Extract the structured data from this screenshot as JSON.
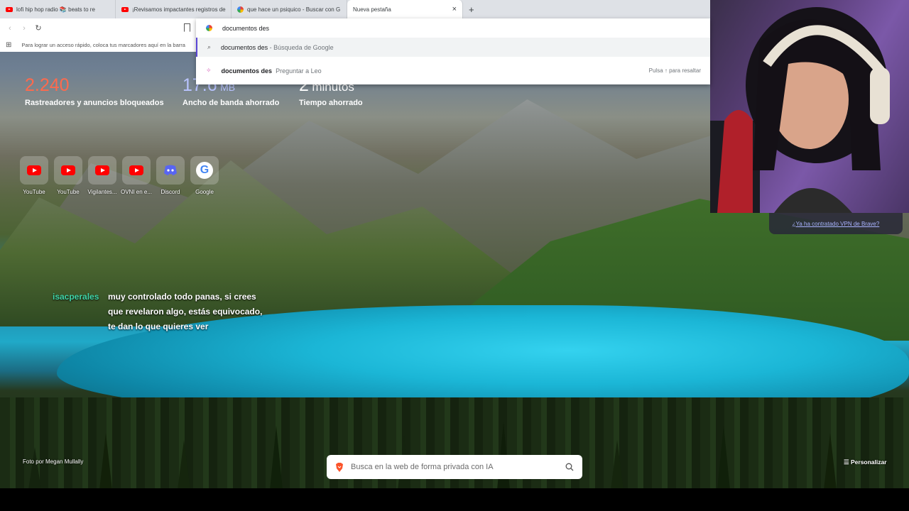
{
  "tabs": [
    {
      "title": "lofi hip hop radio 📚 beats to re",
      "icon": "youtube-icon"
    },
    {
      "title": "¡Revisamos impactantes registros de",
      "icon": "youtube-icon"
    },
    {
      "title": "que hace un psiquico - Buscar con G",
      "icon": "google-icon"
    },
    {
      "title": "Nueva pestaña",
      "icon": "",
      "active": true
    }
  ],
  "tab_close": "×",
  "new_tab": "+",
  "omnibox": {
    "value": "documentos des",
    "suggestions": [
      {
        "query": "documentos des",
        "detail": " - Búsqueda de Google"
      },
      {
        "query": "documentos des",
        "detail": "Preguntar a Leo",
        "hint": "Pulsa ↑ para resaltar"
      }
    ]
  },
  "bookmarks_hint": "Para lograr un acceso rápido, coloca tus marcadores aquí en la barra",
  "stats": [
    {
      "value": "2.240",
      "unit": "",
      "label": "Rastreadores y anuncios bloqueados",
      "color": "#ff6a4d"
    },
    {
      "value": "17.6",
      "unit": "MB",
      "label": "Ancho de banda ahorrado",
      "color": "#b9c4ff"
    },
    {
      "value": "2",
      "unit": "minutos",
      "label": "Tiempo ahorrado",
      "color": "#ffffff"
    }
  ],
  "top_sites": [
    {
      "name": "YouTube",
      "icon": "youtube-icon"
    },
    {
      "name": "YouTube",
      "icon": "youtube-icon"
    },
    {
      "name": "Vigilantes...",
      "icon": "youtube-icon"
    },
    {
      "name": "OVNI en e...",
      "icon": "youtube-icon"
    },
    {
      "name": "Discord",
      "icon": "discord-icon"
    },
    {
      "name": "Google",
      "icon": "google-icon"
    }
  ],
  "chat": {
    "user": "isacperales",
    "message": "muy controlado todo panas, si crees que revelaron algo, estás equivocado, te dan lo que quieres ver"
  },
  "vpn_link": "¿Ya ha contratado VPN de Brave?",
  "photo_credit": "Foto por Megan Mullally",
  "customize": "Personalizar",
  "search": {
    "placeholder": "Busca en la web de forma privada con IA"
  },
  "colors": {
    "accent_purple": "#5b46d6",
    "brave_orange": "#fb542b"
  }
}
